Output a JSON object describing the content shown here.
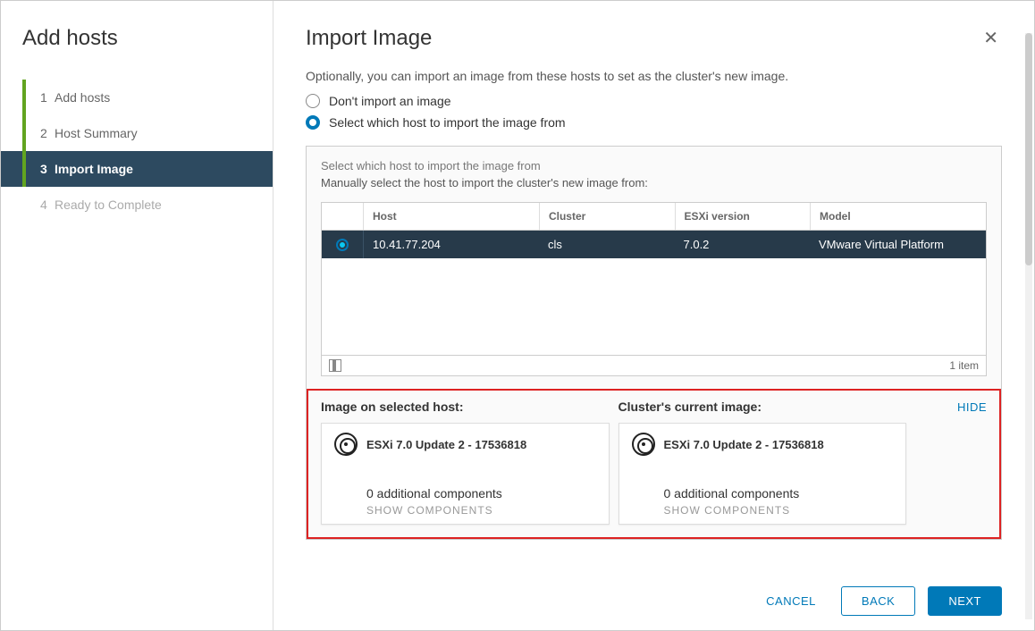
{
  "sidebar": {
    "title": "Add hosts",
    "steps": [
      {
        "num": "1",
        "label": "Add hosts"
      },
      {
        "num": "2",
        "label": "Host Summary"
      },
      {
        "num": "3",
        "label": "Import Image"
      },
      {
        "num": "4",
        "label": "Ready to Complete"
      }
    ]
  },
  "main": {
    "title": "Import Image",
    "intro": "Optionally, you can import an image from these hosts to set as the cluster's new image.",
    "radios": {
      "opt1": "Don't import an image",
      "opt2": "Select which host to import the image from"
    },
    "panel": {
      "title": "Select which host to import the image from",
      "sub": "Manually select the host to import the cluster's new image from:"
    },
    "table": {
      "headers": {
        "host": "Host",
        "cluster": "Cluster",
        "esxi": "ESXi version",
        "model": "Model"
      },
      "row": {
        "host": "10.41.77.204",
        "cluster": "cls",
        "esxi": "7.0.2",
        "model": "VMware Virtual Platform"
      },
      "footer": "1 item"
    },
    "compare": {
      "left_label": "Image on selected host:",
      "right_label": "Cluster's current image:",
      "hide": "HIDE",
      "left_card": {
        "title": "ESXi 7.0 Update 2 - 17536818",
        "line": "0 additional components",
        "link": "SHOW COMPONENTS"
      },
      "right_card": {
        "title": "ESXi 7.0 Update 2 - 17536818",
        "line": "0 additional components",
        "link": "SHOW COMPONENTS"
      }
    },
    "footer": {
      "cancel": "CANCEL",
      "back": "BACK",
      "next": "NEXT"
    }
  }
}
